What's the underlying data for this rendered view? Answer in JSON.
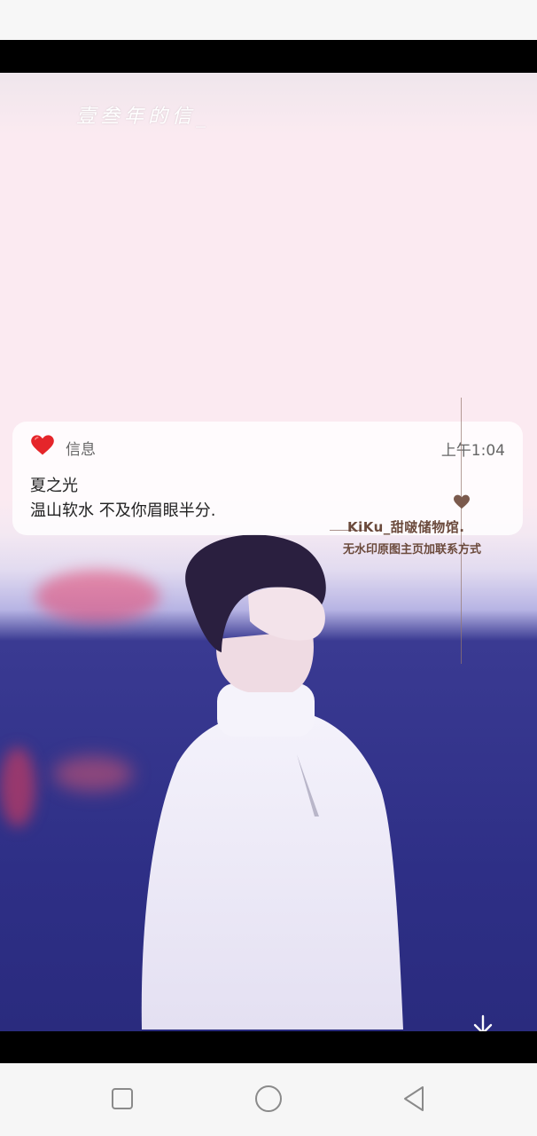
{
  "wallpaper": {
    "handwriting": "壹叁年的信_"
  },
  "notification": {
    "app_name": "信息",
    "time": "上午1:04",
    "sender": "夏之光",
    "message": "温山软水 不及你眉眼半分."
  },
  "watermark": {
    "title": "KiKu_甜啵储物馆.",
    "subtitle": "无水印原图主页加联系方式"
  },
  "icons": {
    "notif_icon": "red-heart-icon",
    "download": "download-icon",
    "nav": [
      "recents-square-icon",
      "home-circle-icon",
      "back-triangle-icon"
    ]
  },
  "colors": {
    "wallpaper_top": "#fbeaf1",
    "wallpaper_bottom": "#2e2f86",
    "watermark": "#6b4a3c",
    "heart": "#e5252a"
  }
}
